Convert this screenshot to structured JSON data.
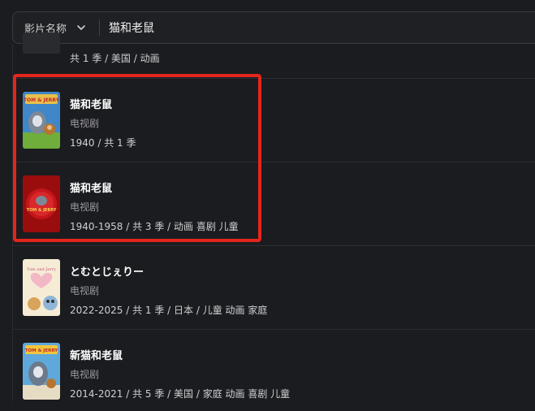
{
  "search": {
    "field_label": "影片名称",
    "query": "猫和老鼠"
  },
  "results": [
    {
      "title": "",
      "type": "",
      "meta": "共 1 季 / 美国 / 动画"
    },
    {
      "title": "猫和老鼠",
      "type": "电视剧",
      "meta": "1940 / 共 1 季"
    },
    {
      "title": "猫和老鼠",
      "type": "电视剧",
      "meta": "1940-1958 / 共 3 季 / 动画 喜剧 儿童"
    },
    {
      "title": "とむとじぇりー",
      "type": "电视剧",
      "meta": "2022-2025 / 共 1 季 / 日本 / 儿童 动画 家庭"
    },
    {
      "title": "新猫和老鼠",
      "type": "电视剧",
      "meta": "2014-2021 / 共 5 季 / 美国 / 家庭 动画 喜剧 儿童"
    }
  ],
  "poster_text": {
    "tom_jerry_logo": "TOM & JERRY",
    "tom_jerry_logo_2": "TOM & JERRY",
    "tom_jerry_logo_3": "Tom and Jerry",
    "tom_jerry_logo_4": "TOM & JERRY"
  },
  "colors": {
    "background": "#1b1c1f",
    "highlight": "#e3261c"
  }
}
